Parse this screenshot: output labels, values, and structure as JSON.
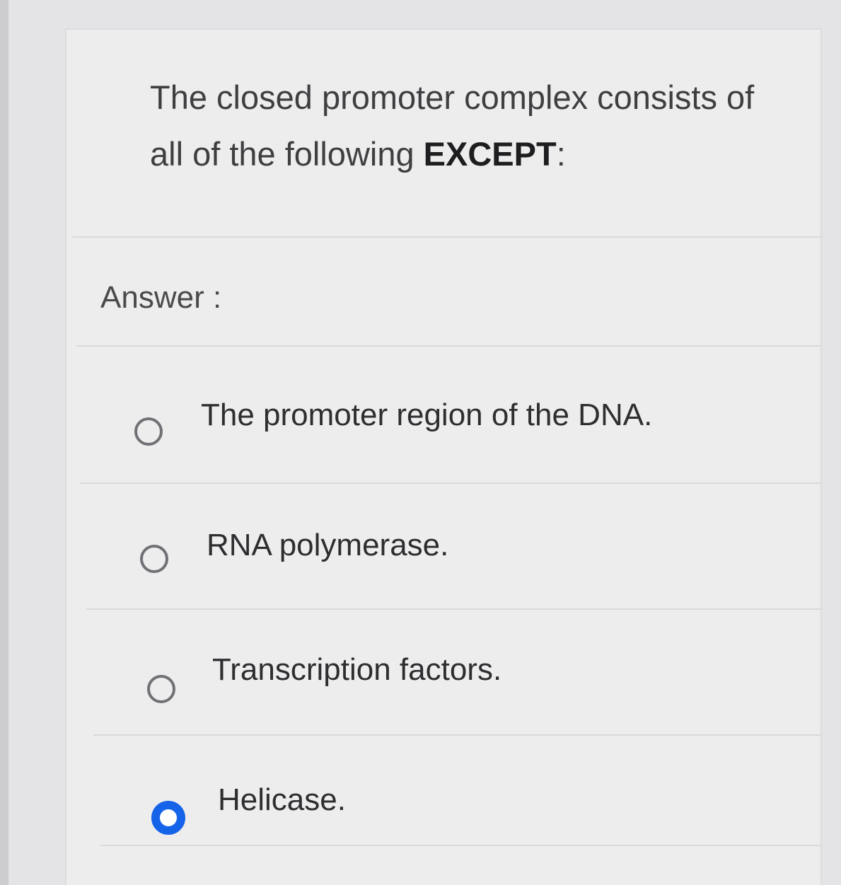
{
  "question": {
    "text_prefix": "The closed promoter complex consists of all of the following ",
    "emphasis": "EXCEPT",
    "suffix": ":"
  },
  "answer_label": "Answer :",
  "options": [
    {
      "label": "The promoter region of the DNA.",
      "selected": false
    },
    {
      "label": "RNA polymerase.",
      "selected": false
    },
    {
      "label": "Transcription factors.",
      "selected": false
    },
    {
      "label": "Helicase.",
      "selected": true
    }
  ],
  "colors": {
    "selected_radio": "#1463e8",
    "background": "#ededee"
  }
}
